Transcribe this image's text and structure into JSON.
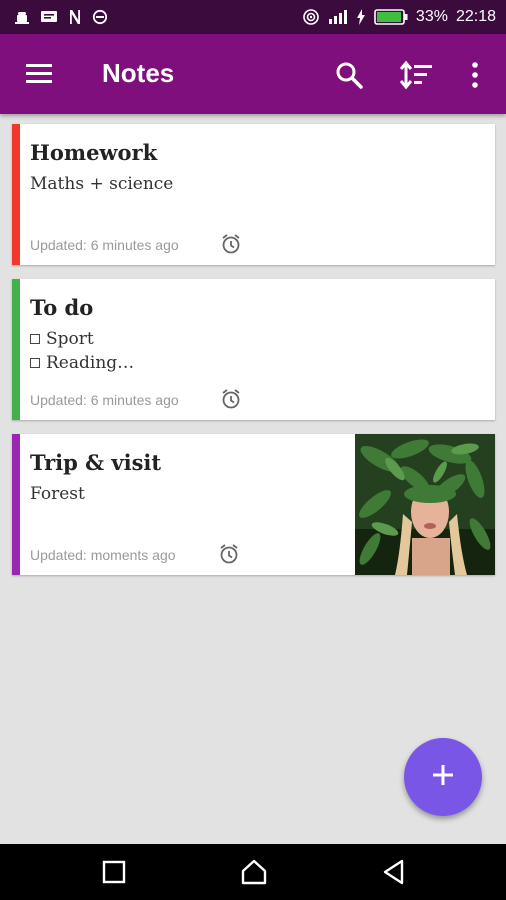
{
  "status_bar": {
    "battery": "33%",
    "time": "22:18",
    "left_icons": [
      "android-debug-icon",
      "message-icon",
      "n-letter-icon",
      "block-icon"
    ],
    "right_icons": [
      "nfc-icon",
      "signal-icon",
      "charging-bolt-icon",
      "battery-icon"
    ]
  },
  "app_bar": {
    "title": "Notes",
    "background": "#7f0f7c",
    "icons": [
      "menu-icon",
      "search-icon",
      "sort-icon",
      "more-vert-icon"
    ]
  },
  "notes": [
    {
      "title": "Homework",
      "lines": [
        "Maths + science"
      ],
      "updated": "Updated: 6 minutes ago",
      "color": "#f2382c",
      "has_alarm_icon": true
    },
    {
      "title": "To do",
      "checklist": [
        "Sport",
        "Reading…"
      ],
      "updated": "Updated: 6 minutes ago",
      "color": "#43b04a",
      "has_alarm_icon": true
    },
    {
      "title": "Trip & visit",
      "lines": [
        "Forest"
      ],
      "updated": "Updated: moments ago",
      "color": "#9b27b0",
      "has_alarm_icon": true,
      "has_photo": true
    }
  ],
  "fab": {
    "icon": "plus-icon",
    "color": "#7a56e6"
  },
  "nav_bar": {
    "icons": [
      "recents-square-icon",
      "home-icon",
      "back-triangle-icon"
    ]
  }
}
